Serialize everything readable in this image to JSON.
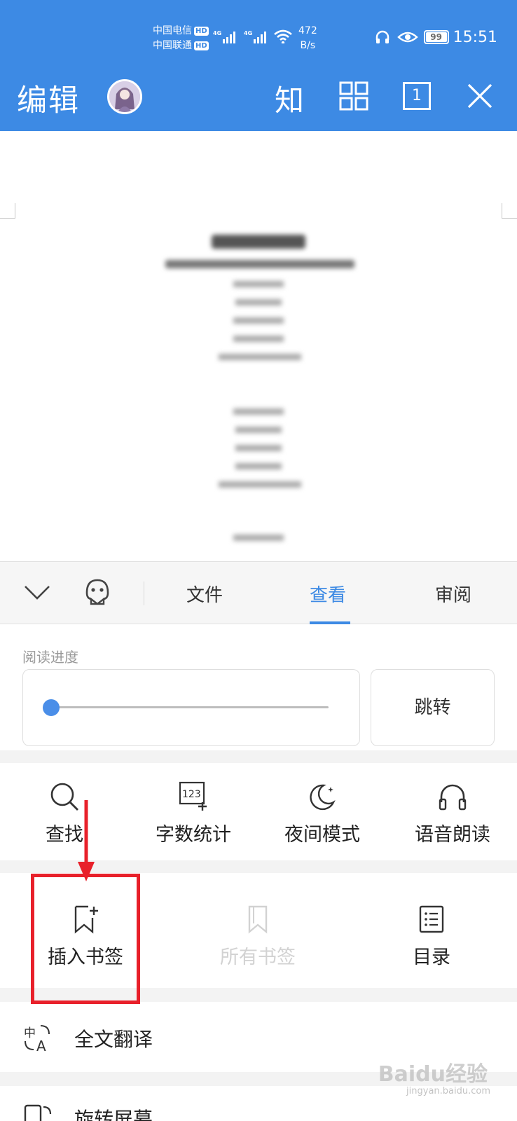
{
  "status_bar": {
    "carrier1": "中国电信",
    "carrier2": "中国联通",
    "hd": "HD",
    "net_label": "4G",
    "speed": "472",
    "speed_unit": "B/s",
    "battery": "99",
    "time": "15:51"
  },
  "titlebar": {
    "title": "编辑",
    "zhi_label": "知",
    "page_count": "1"
  },
  "tabs": {
    "items": [
      "文件",
      "查看",
      "审阅"
    ],
    "active": "查看"
  },
  "reading": {
    "label": "阅读进度",
    "progress_fraction": 0.0,
    "jump_label": "跳转"
  },
  "tools": {
    "row1": [
      "查找",
      "字数统计",
      "夜间模式",
      "语音朗读"
    ],
    "insert_bookmark": "插入书签",
    "all_bookmarks": "所有书签",
    "toc": "目录",
    "full_translate": "全文翻译",
    "rotate_screen": "旋转屏幕"
  },
  "watermark": {
    "brand": "Baidu经验",
    "url": "jingyan.baidu.com"
  },
  "colors": {
    "accent": "#3d8ae4",
    "highlight": "#e8202a"
  }
}
